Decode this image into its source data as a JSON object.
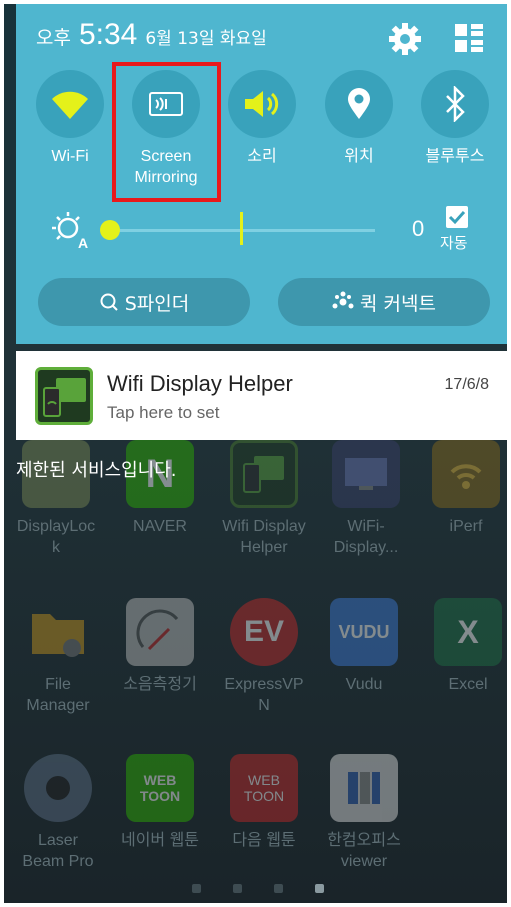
{
  "quick_panel": {
    "ampm": "오후",
    "time": "5:34",
    "date": "6월 13일 화요일",
    "toggles": [
      {
        "label": "Wi-Fi",
        "icon": "wifi-icon"
      },
      {
        "label": "Screen\nMirroring",
        "icon": "screen-mirroring-icon"
      },
      {
        "label": "소리",
        "icon": "sound-icon"
      },
      {
        "label": "위치",
        "icon": "location-icon"
      },
      {
        "label": "블루투스",
        "icon": "bluetooth-icon"
      }
    ],
    "brightness_value": "0",
    "brightness_level": 0.0,
    "auto_label": "자동",
    "sfinder_label": "S파인더",
    "quick_connect_label": "퀵 커넥트",
    "accent": "#4fb6cf",
    "highlight_color": "#e8191c"
  },
  "notification": {
    "title": "Wifi Display Helper",
    "subtitle": "Tap here to set",
    "time": "17/6/8"
  },
  "restricted_text": "제한된 서비스입니다.",
  "home": {
    "apps": [
      {
        "label": "DisplayLoc\nk"
      },
      {
        "label": "NAVER"
      },
      {
        "label": "Wifi Display\nHelper"
      },
      {
        "label": "WiFi-\nDisplay..."
      },
      {
        "label": "iPerf"
      },
      {
        "label": "File\nManager"
      },
      {
        "label": "소음측정기"
      },
      {
        "label": "ExpressVP\nN"
      },
      {
        "label": "Vudu"
      },
      {
        "label": "Excel"
      },
      {
        "label": "Laser\nBeam Pro"
      },
      {
        "label": "네이버 웹툰"
      },
      {
        "label": "다음 웹툰"
      },
      {
        "label": "한컴오피스\nviewer"
      }
    ],
    "icon_texts": {
      "naver": "N",
      "vudu": "VUDU",
      "excel": "X",
      "webtoon_naver": "WEB TOON",
      "webtoon_daum": "WEB TOON"
    },
    "page_dots": 4,
    "active_page": 4
  }
}
